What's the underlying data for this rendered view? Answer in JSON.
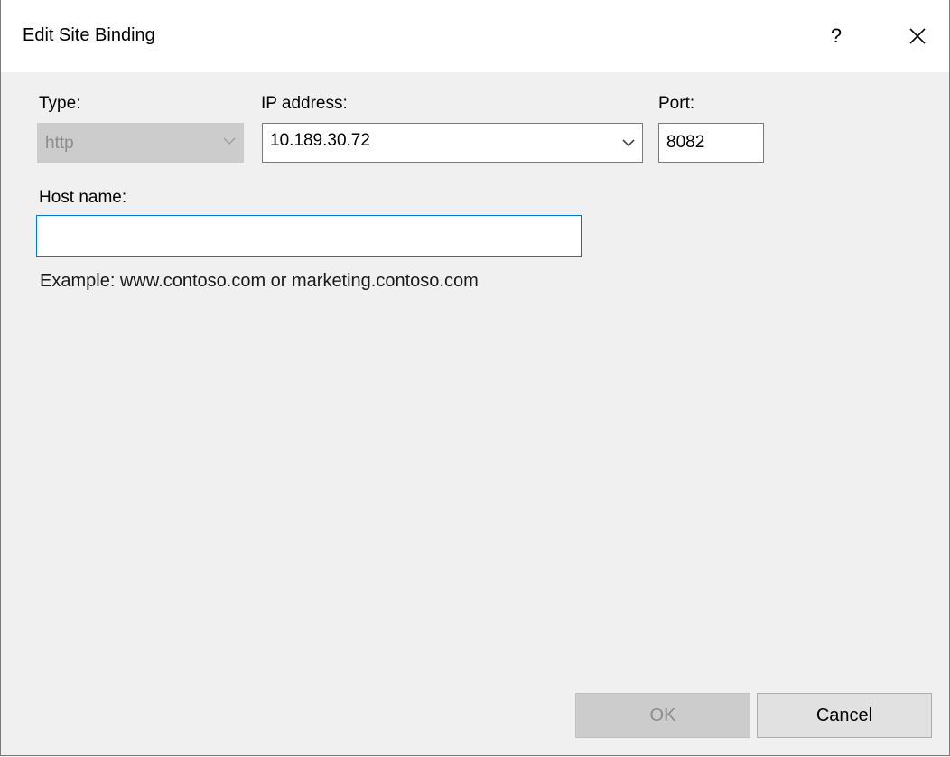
{
  "window": {
    "title": "Edit Site Binding",
    "help_label": "?"
  },
  "form": {
    "type": {
      "label": "Type:",
      "value": "http",
      "enabled": false
    },
    "ip_address": {
      "label": "IP address:",
      "value": "10.189.30.72"
    },
    "port": {
      "label": "Port:",
      "value": "8082"
    },
    "host_name": {
      "label": "Host name:",
      "value": "",
      "placeholder": ""
    },
    "example_text": "Example: www.contoso.com or marketing.contoso.com"
  },
  "buttons": {
    "ok_label": "OK",
    "ok_enabled": false,
    "cancel_label": "Cancel"
  },
  "colors": {
    "focus_border": "#0078d7",
    "disabled_bg": "#cccccc",
    "dialog_bg": "#f0f0f0"
  }
}
